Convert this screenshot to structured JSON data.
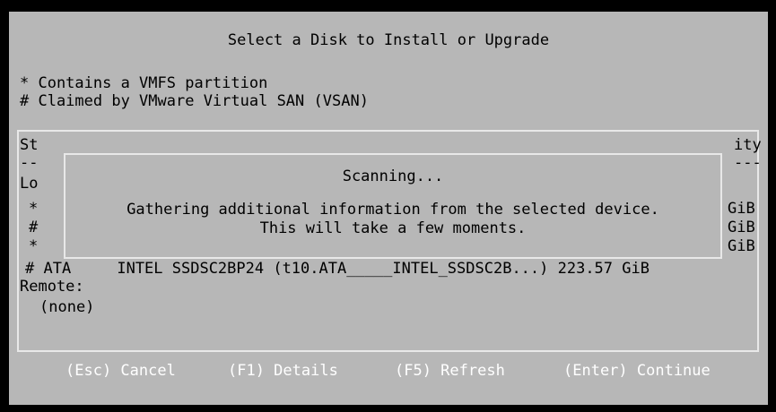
{
  "title": "Select a Disk to Install or Upgrade",
  "legend": [
    "* Contains a VMFS partition",
    "# Claimed by VMware Virtual SAN (VSAN)"
  ],
  "behind_popup": {
    "storage_header_fragment": "St",
    "capacity_header_fragment": "ity",
    "left_dashes": "--",
    "right_dashes": "---",
    "local_label_fragment": "Lo",
    "row_markers": [
      "*",
      "#",
      "*"
    ],
    "row_units": [
      "GiB",
      "GiB",
      "GiB"
    ]
  },
  "popup": {
    "title": "Scanning...",
    "message_line1": "Gathering additional information from the selected device.",
    "message_line2": "This will take a few moments."
  },
  "disk_row": "# ATA     INTEL SSDSC2BP24 (t10.ATA_____INTEL_SSDSC2B...) 223.57 GiB",
  "remote_label": "Remote:",
  "remote_none": "(none)",
  "keys": {
    "cancel": "(Esc) Cancel",
    "details": "(F1) Details",
    "refresh": "(F5) Refresh",
    "continue": "(Enter) Continue"
  },
  "colors": {
    "background": "#000000",
    "dialog": "#b7b7b7",
    "border": "#e8e8e8",
    "text": "#000000",
    "key_text": "#ffffff"
  }
}
